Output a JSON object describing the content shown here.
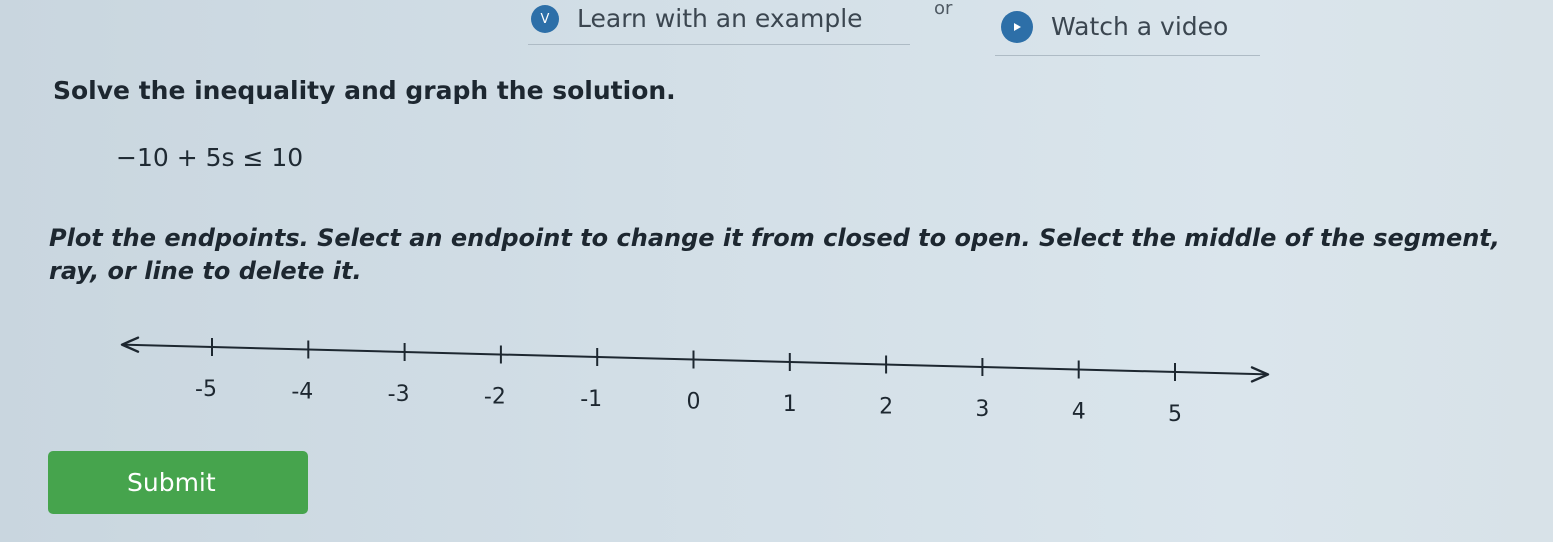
{
  "help": {
    "example_label": "Learn with an example",
    "example_badge": "V",
    "separator": "or",
    "video_label": "Watch a video",
    "video_icon": "play-icon"
  },
  "question": {
    "prompt": "Solve the inequality and graph the solution.",
    "inequality": "−10 + 5s ≤ 10",
    "instructions": "Plot the endpoints. Select an endpoint to change it from closed to open. Select the middle of the segment, ray, or line to delete it."
  },
  "number_line": {
    "ticks": [
      "-5",
      "-4",
      "-3",
      "-2",
      "-1",
      "0",
      "1",
      "2",
      "3",
      "4",
      "5"
    ],
    "min": -5,
    "max": 5,
    "arrows": [
      "left",
      "right"
    ]
  },
  "actions": {
    "submit_label": "Submit",
    "submit_color": "#46a44d"
  },
  "colors": {
    "badge": "#2d6fa8"
  }
}
